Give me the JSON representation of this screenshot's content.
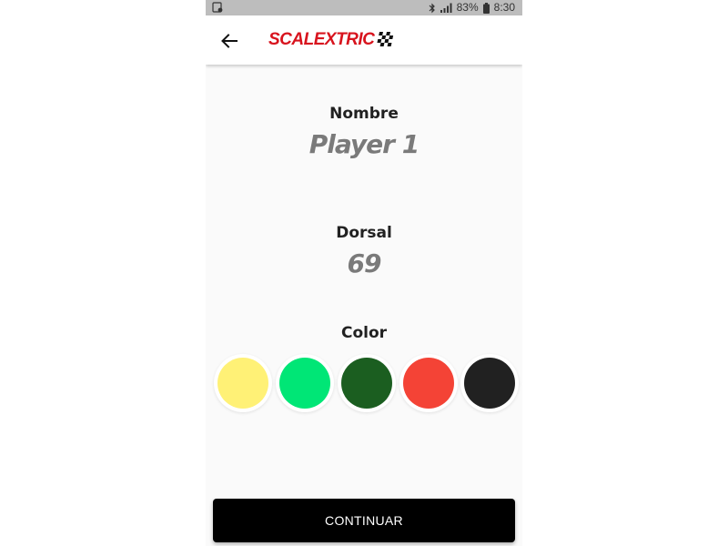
{
  "status_bar": {
    "battery": "83%",
    "time": "8:30",
    "icons": [
      "screenshot-icon",
      "bluetooth-icon",
      "signal-icon",
      "battery-icon"
    ]
  },
  "app_bar": {
    "back_icon": "arrow-left-icon",
    "logo_text": "SCALEXTRIC",
    "logo_flag_icon": "checkered-flag-icon",
    "logo_color": "#d8141e"
  },
  "form": {
    "name_label": "Nombre",
    "name_value": "Player 1",
    "number_label": "Dorsal",
    "number_value": "69",
    "color_label": "Color",
    "colors": [
      "#fff176",
      "#00e676",
      "#1b5e20",
      "#f44336",
      "#212121"
    ]
  },
  "continue_button": {
    "label": "CONTINUAR",
    "color": "#000000"
  }
}
